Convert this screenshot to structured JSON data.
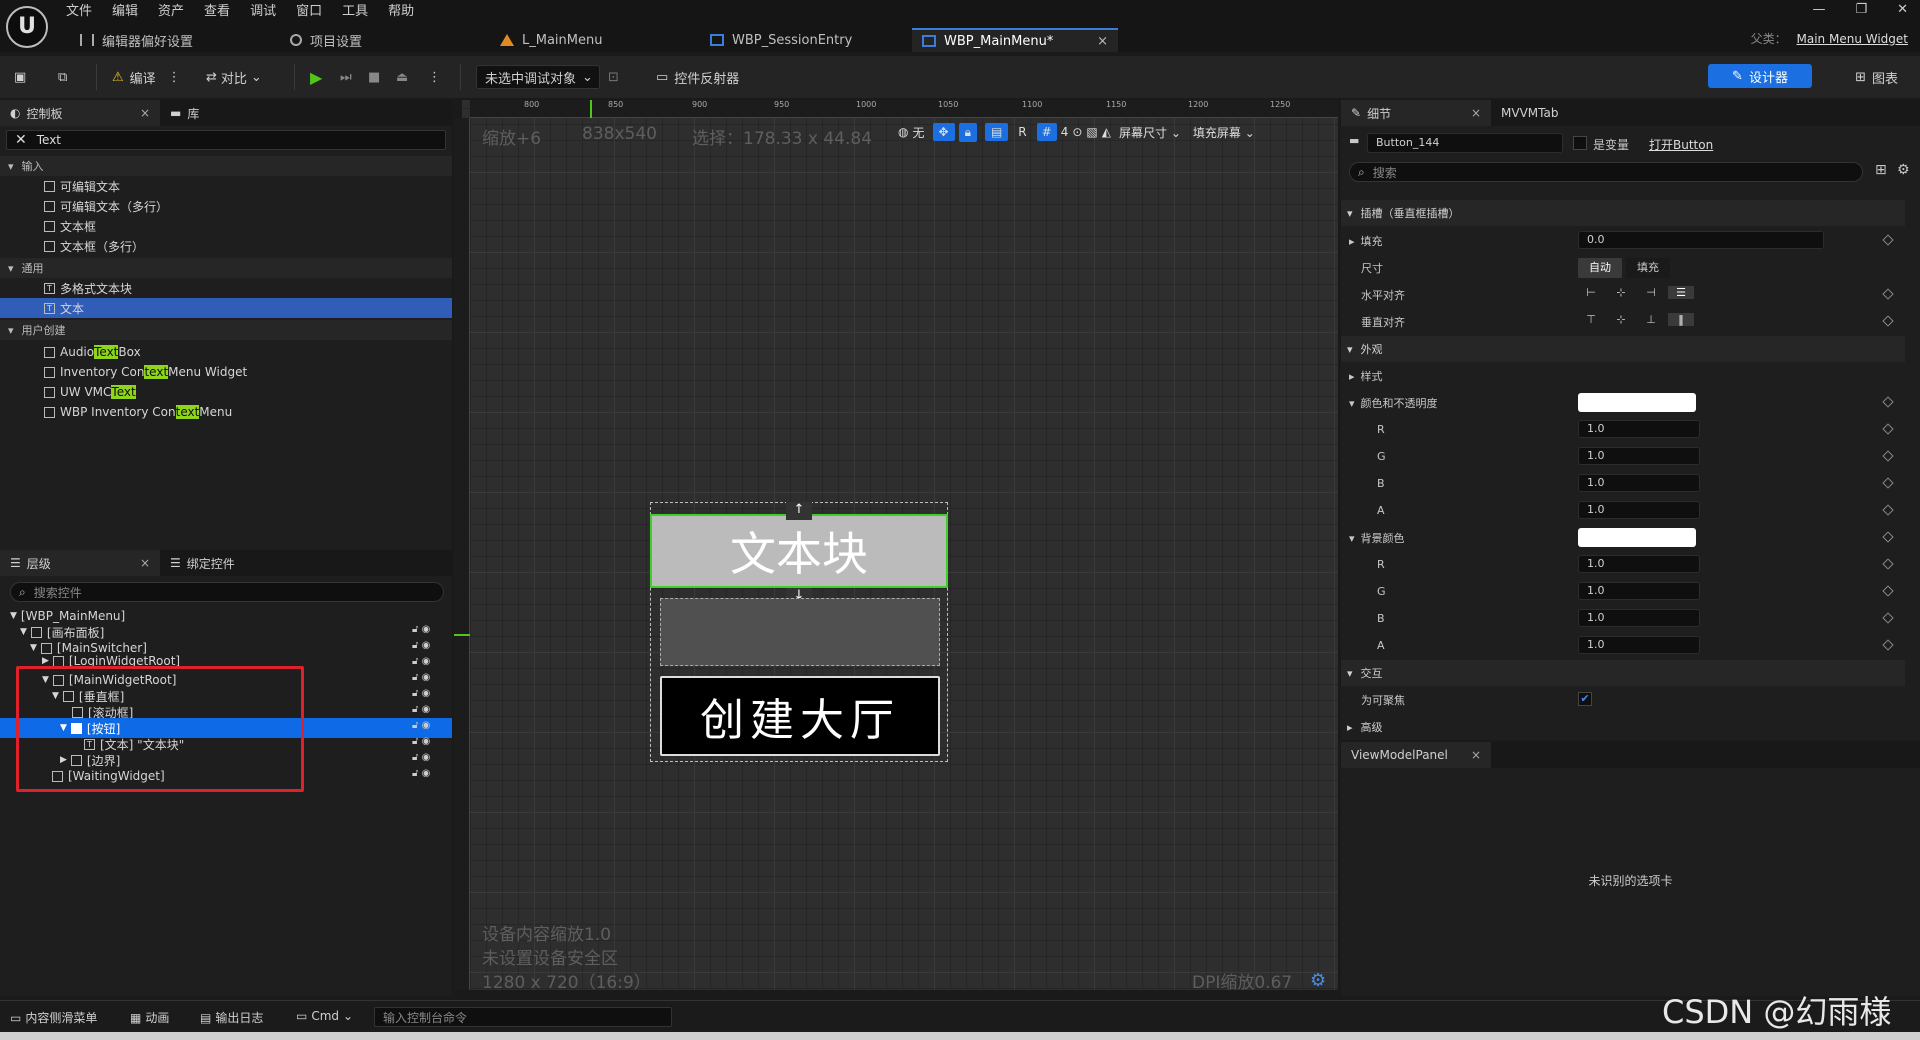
{
  "app": {
    "menu": [
      "文件",
      "编辑",
      "资产",
      "查看",
      "调试",
      "窗口",
      "工具",
      "帮助"
    ],
    "tabs": [
      "编辑器偏好设置",
      "项目设置",
      "L_MainMenu",
      "WBP_SessionEntry",
      "WBP_MainMenu*"
    ],
    "parent_class_label": "父类：",
    "parent_class": "Main Menu Widget"
  },
  "toolbar": {
    "compile": "编译",
    "diff": "对比",
    "debug_target": "未选中调试对象",
    "reflector": "控件反射器",
    "designer": "设计器",
    "graph": "图表"
  },
  "palette": {
    "tab_palette": "控制板",
    "tab_library": "库",
    "search_value": "Text",
    "cat_input": "输入",
    "input_items": [
      "可编辑文本",
      "可编辑文本（多行）",
      "文本框",
      "文本框（多行）"
    ],
    "cat_common": "通用",
    "common_items": [
      "多格式文本块",
      "文本"
    ],
    "cat_user": "用户创建",
    "user_items": [
      {
        "pre": "Audio ",
        "hl": "Text",
        "post": " Box"
      },
      {
        "pre": "Inventory Con",
        "hl": "text",
        "post": " Menu Widget"
      },
      {
        "pre": "UW VMC",
        "hl": "Text",
        "post": ""
      },
      {
        "pre": "WBP Inventory Con",
        "hl": "text",
        "post": " Menu"
      }
    ]
  },
  "hierarchy": {
    "tab_hierarchy": "层级",
    "tab_bind": "绑定控件",
    "search_placeholder": "搜索控件",
    "items": [
      "[WBP_MainMenu]",
      "[画布面板]",
      "[MainSwitcher]",
      "[LoginWidgetRoot]",
      "[MainWidgetRoot]",
      "[垂直框]",
      "[滚动框]",
      "[按钮]",
      "[文本] \"文本块\"",
      "[边界]",
      "[WaitingWidget]"
    ]
  },
  "viewport": {
    "zoom": "缩放+6",
    "size": "838x540",
    "selection": "选择：178.33 x 44.84",
    "none_label": "无",
    "grid_num": "4",
    "screen_size": "屏幕尺寸",
    "fill_screen": "填充屏幕",
    "ruler_top": [
      "800",
      "850",
      "900",
      "950",
      "1000",
      "1050",
      "1100",
      "1150",
      "1200",
      "1250"
    ],
    "button_text": "文本块",
    "bottom_button_text": "创建大厅",
    "info1": "设备内容缩放1.0",
    "info2": "未设置设备安全区",
    "info3": "1280 x 720（16:9）",
    "dpi": "DPI缩放0.67"
  },
  "details": {
    "tab_details": "细节",
    "tab_mvvm": "MVVMTab",
    "name": "Button_144",
    "is_variable": "是变量",
    "open_link": "打开Button",
    "search_placeholder": "搜索",
    "slot_section": "插槽（垂直框插槽）",
    "padding_label": "填充",
    "padding_value": "0.0",
    "size_label": "尺寸",
    "size_auto": "自动",
    "size_fill": "填充",
    "halign_label": "水平对齐",
    "valign_label": "垂直对齐",
    "appearance_section": "外观",
    "style_label": "样式",
    "color_opacity": "颜色和不透明度",
    "bg_color": "背景颜色",
    "channels": [
      "R",
      "G",
      "B",
      "A"
    ],
    "channel_value": "1.0",
    "interaction_section": "交互",
    "focusable": "为可聚焦",
    "advanced_section": "高级",
    "vm_panel": "ViewModelPanel",
    "unrecognized": "未识别的选项卡"
  },
  "statusbar": {
    "content_drawer": "内容侧滑菜单",
    "animation": "动画",
    "output_log": "输出日志",
    "cmd": "Cmd",
    "console_placeholder": "输入控制台命令",
    "watermark": "CSDN @幻雨様"
  }
}
